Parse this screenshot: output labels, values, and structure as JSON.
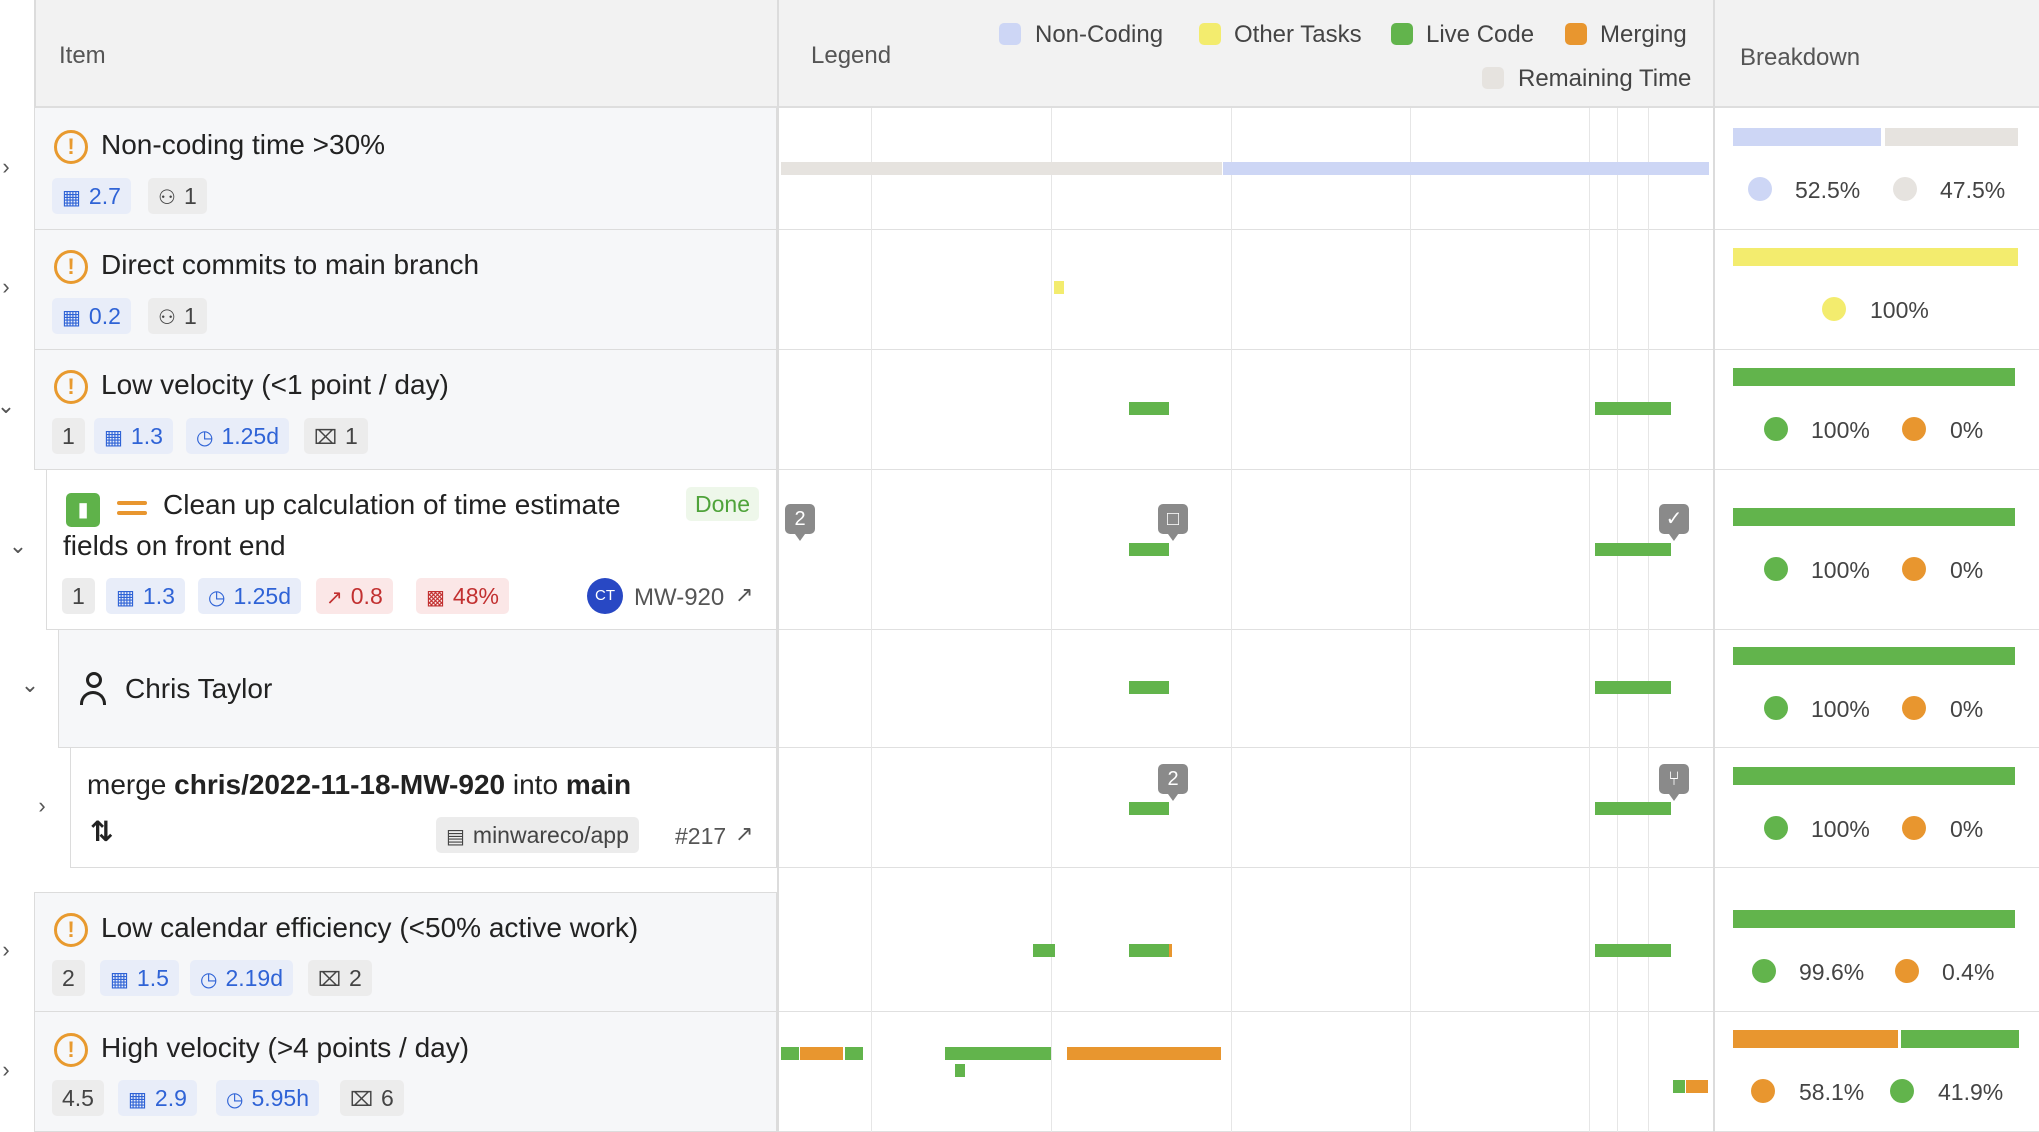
{
  "header": {
    "item": "Item",
    "legend": "Legend",
    "breakdown": "Breakdown",
    "legend_items": [
      {
        "label": "Non-Coding",
        "color": "#cdd6f5"
      },
      {
        "label": "Other Tasks",
        "color": "#f3ec6e"
      },
      {
        "label": "Live Code",
        "color": "#62b44c"
      },
      {
        "label": "Merging",
        "color": "#e8962f"
      },
      {
        "label": "Remaining Time",
        "color": "#e6e3df"
      }
    ]
  },
  "rows": {
    "r1": {
      "title": "Non-coding time >30%",
      "days": "2.7",
      "people": "1",
      "pct1": "52.5%",
      "pct2": "47.5%"
    },
    "r2": {
      "title": "Direct commits to main branch",
      "days": "0.2",
      "people": "1",
      "pct1": "100%"
    },
    "r3": {
      "title": "Low velocity (<1 point / day)",
      "points": "1",
      "days": "1.3",
      "time": "1.25d",
      "tickets": "1",
      "pct1": "100%",
      "pct2": "0%"
    },
    "r4": {
      "title_line1": "Clean up calculation of time estimate",
      "title_line2": "fields on front end",
      "status": "Done",
      "points": "1",
      "days": "1.3",
      "time": "1.25d",
      "trend": "0.8",
      "efficiency": "48%",
      "avatar": "CT",
      "issue_key": "MW-920",
      "marker_left": "2",
      "pct1": "100%",
      "pct2": "0%"
    },
    "r5": {
      "name": "Chris Taylor",
      "pct1": "100%",
      "pct2": "0%"
    },
    "r6": {
      "prefix": "merge ",
      "branch": "chris/2022-11-18-MW-920",
      "mid": " into ",
      "target": "main",
      "repo": "minwareco/app",
      "pr": "#217",
      "marker": "2",
      "pct1": "100%",
      "pct2": "0%"
    },
    "r7": {
      "title": "Low calendar efficiency (<50% active work)",
      "points": "2",
      "days": "1.5",
      "time": "2.19d",
      "tickets": "2",
      "pct1": "99.6%",
      "pct2": "0.4%"
    },
    "r8": {
      "title": "High velocity (>4 points / day)",
      "points": "4.5",
      "days": "2.9",
      "time": "5.95h",
      "tickets": "6",
      "pct1": "58.1%",
      "pct2": "41.9%"
    }
  }
}
